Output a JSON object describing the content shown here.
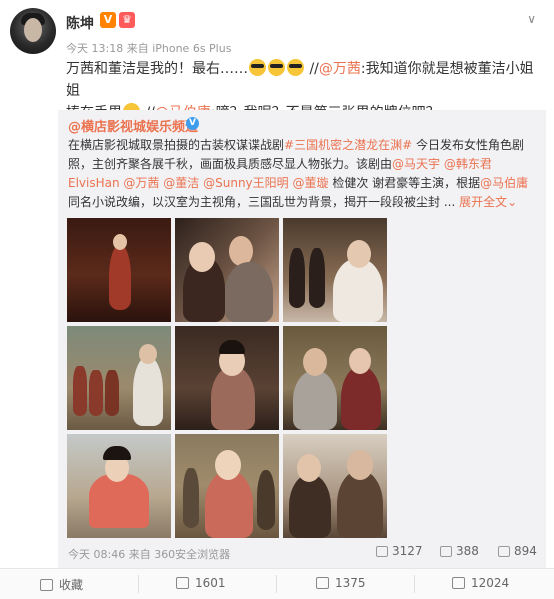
{
  "post": {
    "author": "陈坤",
    "meta": "今天 13:18 来自 iPhone 6s Plus",
    "text_line1_a": "万茜和董洁是我的！最右……",
    "text_line1_b": " //",
    "mention_wanqian": "@万茜",
    "text_line1_c": ":我知道你就是想被董洁小姐姐",
    "text_line2_a": "捧在手里",
    "text_line2_b": " //",
    "mention_maboyong": "@马伯庸",
    "text_line2_c": ":嘀？我呢？不是第三张里的牌位吧？"
  },
  "repost": {
    "author": "@横店影视城娱乐频道",
    "text_a": "在横店影视城取景拍摄的古装权谋谍战剧",
    "hashtag": "#三国机密之潜龙在渊#",
    "text_b": " 今日发布女性角色剧照，主创齐聚各展千秋，画面极具质感尽显人物张力。该剧由",
    "m1": "@马天宇",
    "m2": "@韩东君ElvisHan",
    "m3": "@万茜",
    "m4": "@董洁",
    "m5": "@Sunny王阳明",
    "m6": "@董璇",
    "text_c": " 检健次 谢君豪等主演，根据",
    "m7": "@马伯庸",
    "text_d": " 同名小说改编，以汉室为主视角，三国乱世为背景，揭开一段段被尘封 ...",
    "expand": "展开全文",
    "expand_arrow": "⌄",
    "meta": "今天 08:46 来自 360安全浏览器",
    "reposts": "3127",
    "comments": "388",
    "likes": "894"
  },
  "actions": {
    "favorite": "收藏",
    "repost": "1601",
    "comment": "1375",
    "like": "12024"
  },
  "icons": {
    "verified": "V",
    "member": "♛",
    "chevron": "∨"
  }
}
